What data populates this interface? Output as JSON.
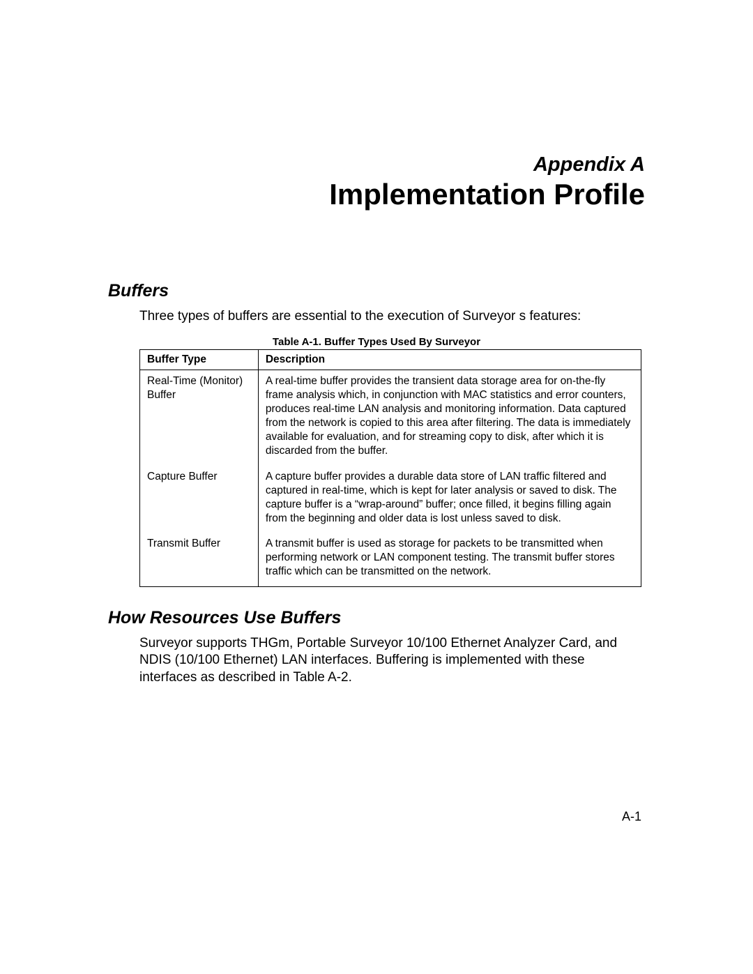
{
  "header": {
    "appendix_label": "Appendix A",
    "title": "Implementation Profile"
  },
  "sections": {
    "buffers": {
      "heading": "Buffers",
      "intro": "Three types of buffers are essential to the execution of Surveyor s features:"
    },
    "how_resources": {
      "heading": "How Resources Use Buffers",
      "body": "Surveyor supports THGm, Portable Surveyor 10/100 Ethernet Analyzer Card, and NDIS (10/100 Ethernet) LAN interfaces. Buffering is implemented with these interfaces as described in Table A-2."
    }
  },
  "table": {
    "caption": "Table A-1. Buffer Types Used By Surveyor",
    "headers": {
      "type": "Buffer Type",
      "description": "Description"
    },
    "rows": [
      {
        "type": "Real-Time (Monitor) Buffer",
        "description": "A real-time buffer provides the transient data storage area for on-the-fly frame analysis which, in conjunction with MAC statistics and error counters, produces real-time LAN analysis and monitoring information. Data captured from the network is copied to this area after filtering. The data is immediately available for evaluation, and for streaming copy to disk, after which it is discarded from the buffer."
      },
      {
        "type": "Capture Buffer",
        "description": "A capture buffer provides a durable data store of LAN traffic filtered and captured in real-time, which is kept for later analysis or saved to disk. The capture buffer is a “wrap-around” buffer; once filled, it begins filling again from the beginning and older data is lost unless saved to disk."
      },
      {
        "type": "Transmit Buffer",
        "description": "A transmit buffer is used as storage for packets to be transmitted when performing network or LAN component testing. The transmit buffer stores traffic which can be transmitted on the network."
      }
    ]
  },
  "footer": {
    "page_number": "A-1"
  }
}
